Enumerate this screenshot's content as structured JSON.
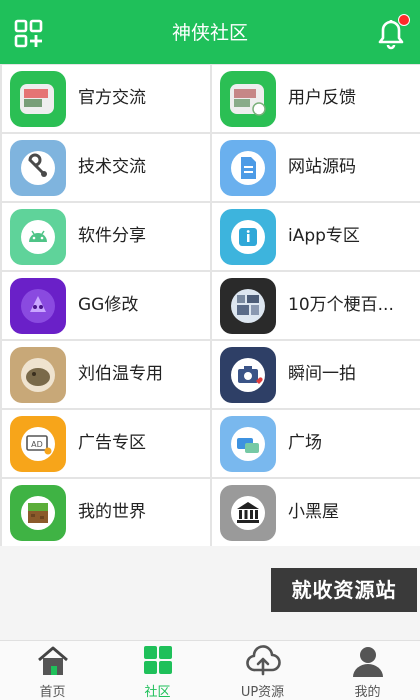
{
  "header": {
    "title": "神侠社区",
    "menu_icon": "grid-plus-icon",
    "notify_icon": "bell-icon",
    "accent": "#1fc05a"
  },
  "sections": [
    {
      "label": "官方交流",
      "icon": "official-chat-icon"
    },
    {
      "label": "用户反馈",
      "icon": "user-feedback-icon"
    },
    {
      "label": "技术交流",
      "icon": "wrench-icon"
    },
    {
      "label": "网站源码",
      "icon": "source-file-icon"
    },
    {
      "label": "软件分享",
      "icon": "android-icon"
    },
    {
      "label": "iApp专区",
      "icon": "iapp-icon"
    },
    {
      "label": "GG修改",
      "icon": "gg-modifier-icon"
    },
    {
      "label": "10万个梗百...",
      "icon": "meme-encyclopedia-icon"
    },
    {
      "label": "刘伯温专用",
      "icon": "liu-bowen-icon"
    },
    {
      "label": "瞬间一拍",
      "icon": "camera-icon"
    },
    {
      "label": "广告专区",
      "icon": "ad-icon"
    },
    {
      "label": "广场",
      "icon": "plaza-icon"
    },
    {
      "label": "我的世界",
      "icon": "minecraft-icon"
    },
    {
      "label": "小黑屋",
      "icon": "bank-building-icon"
    }
  ],
  "watermark": "就收资源站",
  "tabs": [
    {
      "label": "首页",
      "icon": "home-icon",
      "active": false
    },
    {
      "label": "社区",
      "icon": "community-grid-icon",
      "active": true
    },
    {
      "label": "UP资源",
      "icon": "cloud-upload-icon",
      "active": false
    },
    {
      "label": "我的",
      "icon": "profile-icon",
      "active": false
    }
  ]
}
